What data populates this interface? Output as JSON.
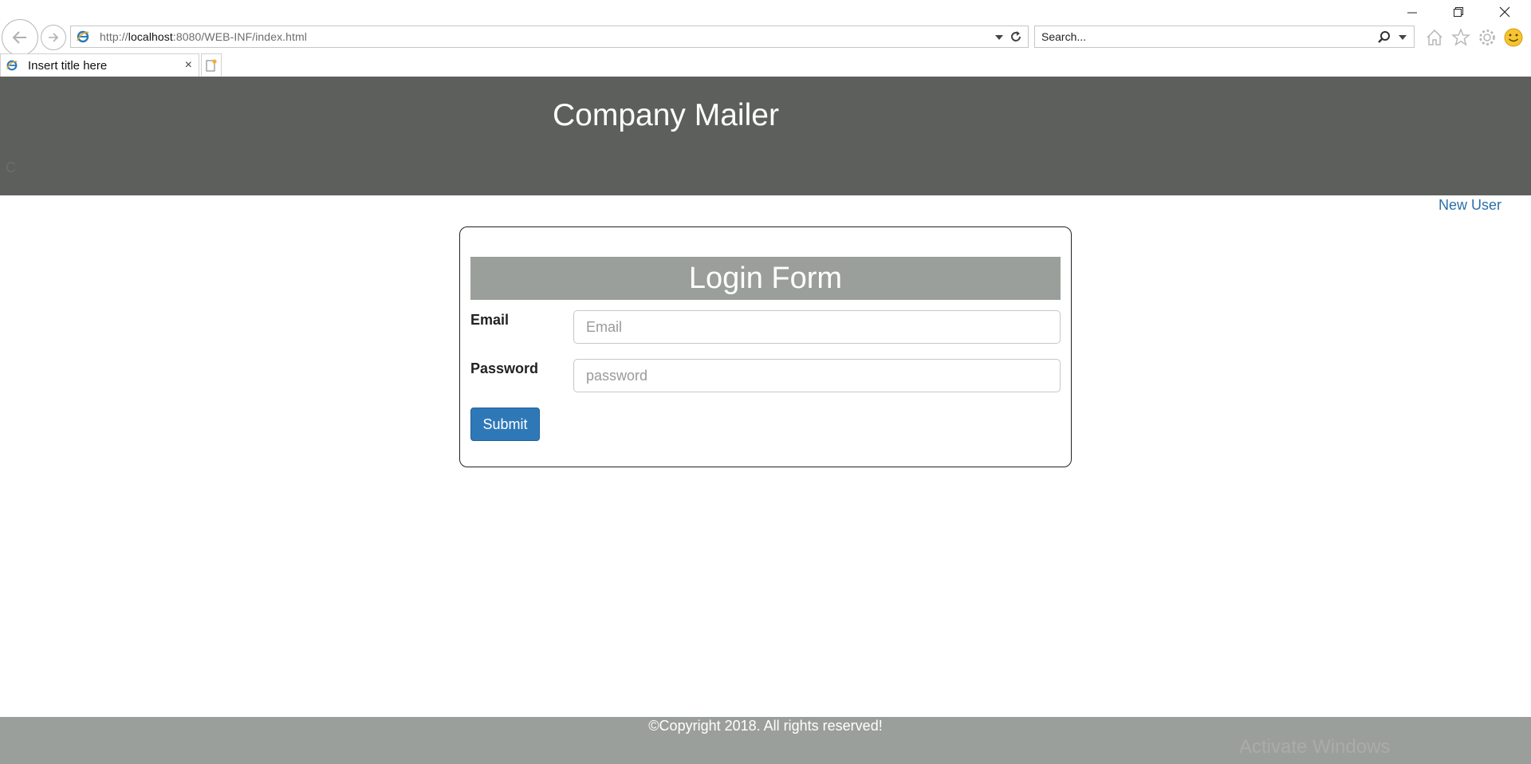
{
  "browser": {
    "url_prefix": "http://",
    "url_host": "localhost",
    "url_rest": ":8080/WEB-INF/index.html",
    "search_placeholder": "Search...",
    "tab_title": "Insert title here",
    "tab_close": "×"
  },
  "header": {
    "title": "Company Mailer",
    "ghost_text": "C"
  },
  "nav": {
    "new_user": "New User"
  },
  "login": {
    "heading": "Login Form",
    "email_label": "Email",
    "email_placeholder": "Email",
    "password_label": "Password",
    "password_placeholder": "password",
    "submit_label": "Submit"
  },
  "footer": {
    "copyright": "©Copyright 2018. All rights reserved!",
    "watermark": "Activate Windows"
  },
  "colors": {
    "header_bg": "#5d5f5d",
    "card_heading_bg": "#9b9f9b",
    "footer_bg": "#9b9f9b",
    "primary_button": "#2f78b8",
    "link": "#2a6fa8"
  }
}
